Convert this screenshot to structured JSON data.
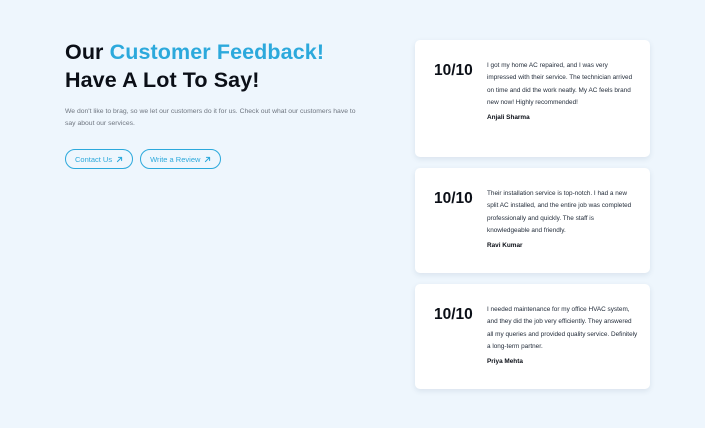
{
  "heading": {
    "line1_prefix": "Our",
    "line1_accent": "Customer Feedback!",
    "line2": "Have A Lot To Say!"
  },
  "description": "We don't like to brag, so we let our customers do it for us. Check out what our customers have to say about our services.",
  "buttons": {
    "contact": "Contact Us",
    "review": "Write a Review"
  },
  "colors": {
    "accent": "#2ca9dc",
    "background": "#eef6fd",
    "text": "#0b0f17"
  },
  "testimonials": [
    {
      "score": "10/10",
      "text": "I got my home AC repaired, and I was very impressed with their service. The technician arrived on time and did the work neatly. My AC feels brand new now! Highly recommended!",
      "name": "Anjali Sharma"
    },
    {
      "score": "10/10",
      "text": "Their installation service is top-notch. I had a new split AC installed, and the entire job was completed professionally and quickly. The staff is knowledgeable and friendly.",
      "name": "Ravi Kumar"
    },
    {
      "score": "10/10",
      "text": "I needed maintenance for my office HVAC system, and they did the job very efficiently. They answered all my queries and provided quality service. Definitely a long-term partner.",
      "name": "Priya Mehta"
    }
  ]
}
